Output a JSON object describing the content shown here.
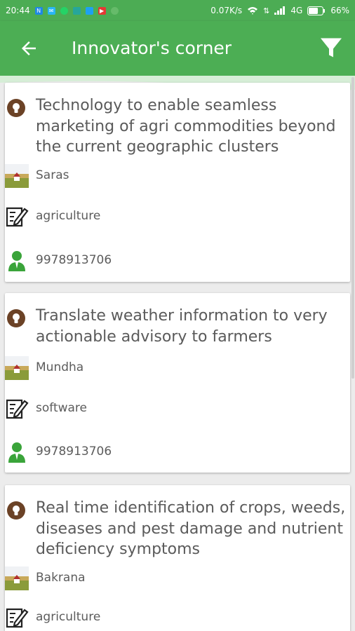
{
  "status_bar": {
    "time": "20:44",
    "speed": "0.07K/s",
    "network": "4G",
    "battery": "66%"
  },
  "app_bar": {
    "title": "Innovator's corner",
    "back_icon": "arrow-back-icon",
    "filter_icon": "filter-icon"
  },
  "cards": [
    {
      "title": "Technology to enable seamless marketing of agri commodities beyond the current geographic clusters",
      "name": "Saras",
      "category": "agriculture",
      "phone": "9978913706"
    },
    {
      "title": "Translate weather information to very actionable advisory to farmers",
      "name": "Mundha",
      "category": "software",
      "phone": "9978913706"
    },
    {
      "title": "Real time identification of crops, weeds, diseases and pest damage and nutrient deficiency symptoms",
      "name": "Bakrana",
      "category": "agriculture"
    }
  ],
  "colors": {
    "primary": "#4cae54",
    "bulb": "#6b4226",
    "person": "#3aa43a"
  }
}
